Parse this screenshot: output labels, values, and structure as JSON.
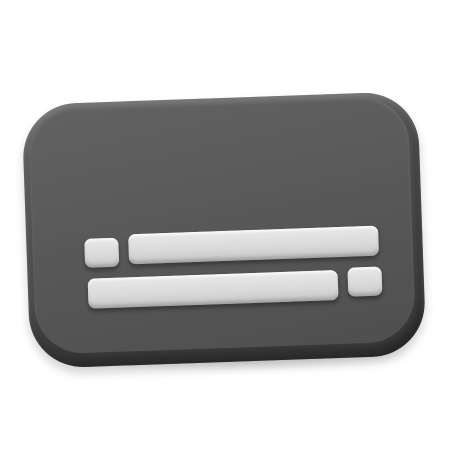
{
  "icon": {
    "name": "credit-card-icon",
    "card_color": "#555555",
    "bar_color": "#dcdcdc",
    "background_color": "#ffffff"
  }
}
